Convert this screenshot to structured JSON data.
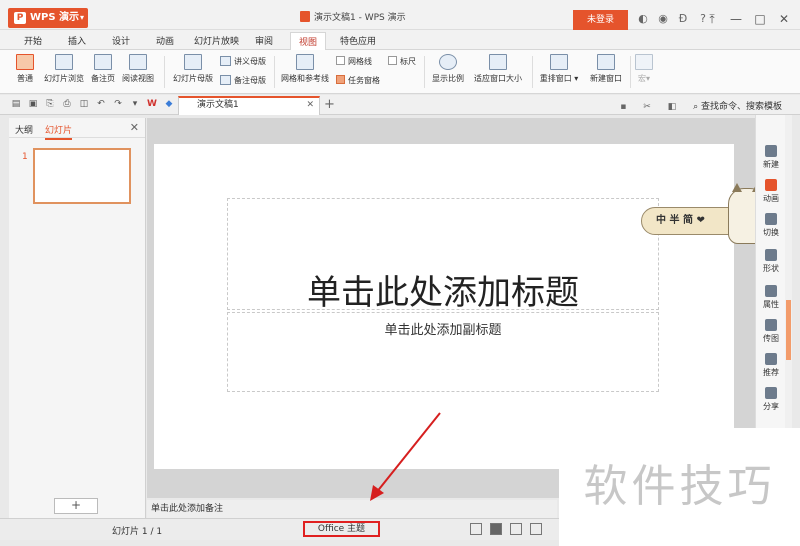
{
  "app": {
    "name": "WPS 演示",
    "doc_title": "演示文稿1 - WPS 演示",
    "login": "未登录"
  },
  "tabs": [
    "开始",
    "插入",
    "设计",
    "动画",
    "幻灯片放映",
    "审阅",
    "视图",
    "特色应用"
  ],
  "active_tab": "视图",
  "ribbon": {
    "normal": "普通",
    "slide_browse": "幻灯片浏览",
    "notes_page": "备注页",
    "reading_view": "阅读视图",
    "slide_master": "幻灯片母版",
    "handout_master": "讲义母版",
    "notes_master": "备注母版",
    "grid_guides": "网格和参考线",
    "gridlines": "网格线",
    "ruler": "标尺",
    "task_pane": "任务窗格",
    "zoom": "显示比例",
    "fit_window": "适应窗口大小",
    "arrange_window": "重排窗口",
    "new_window": "新建窗口",
    "macro": "宏"
  },
  "quickbar": {
    "doc_tab": "演示文稿1",
    "search": "查找命令、搜索模板"
  },
  "left_panel": {
    "tab_outline": "大纲",
    "tab_slides": "幻灯片",
    "slide_number": "1",
    "add_button": "+"
  },
  "slide": {
    "title": "单击此处添加标题",
    "subtitle": "单击此处添加副标题"
  },
  "mascot": {
    "text": "中 半 简 ❤"
  },
  "right_bar": [
    "新建",
    "动画",
    "切换",
    "形状",
    "属性",
    "传图",
    "推荐",
    "分享"
  ],
  "notes": "单击此处添加备注",
  "status": {
    "slide": "幻灯片 1 / 1",
    "theme": "Office 主题"
  },
  "watermark": "软件技巧",
  "colors": {
    "accent": "#e5542c",
    "highlight_box": "#e02020"
  }
}
